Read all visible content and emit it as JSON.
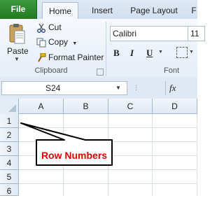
{
  "tabs": {
    "file": "File",
    "home": "Home",
    "insert": "Insert",
    "page_layout": "Page Layout",
    "more": "F"
  },
  "clipboard": {
    "paste": "Paste",
    "cut": "Cut",
    "copy": "Copy",
    "format_painter": "Format Painter",
    "group_label": "Clipboard"
  },
  "font": {
    "name": "Calibri",
    "size": "11",
    "bold": "B",
    "italic": "I",
    "underline": "U",
    "group_label": "Font"
  },
  "formula_bar": {
    "name_box": "S24",
    "fx": "fx"
  },
  "sheet": {
    "columns": [
      "A",
      "B",
      "C",
      "D"
    ],
    "rows": [
      "1",
      "2",
      "3",
      "4",
      "5",
      "6"
    ]
  },
  "callout": {
    "text": "Row Numbers",
    "color": "#e00000"
  },
  "colors": {
    "file_tab": "#2a832a",
    "ribbon": "#e5edf8",
    "header_border": "#9eb6ce"
  }
}
